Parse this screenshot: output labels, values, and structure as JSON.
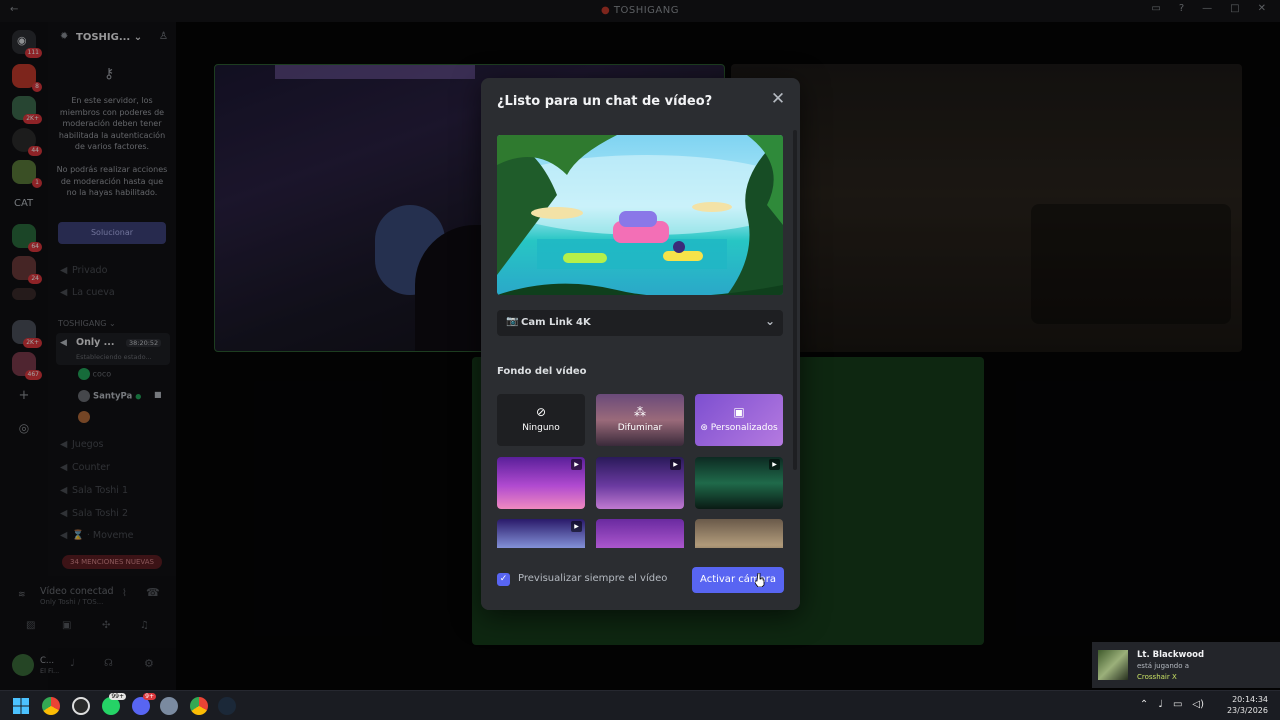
{
  "window": {
    "title": "TOSHIGANG"
  },
  "rail": {
    "category_label": "CAT",
    "servers": [
      {
        "badge": "111"
      },
      {
        "badge": "8"
      },
      {
        "badge": "2K+"
      },
      {
        "badge": "44"
      },
      {
        "badge": "1"
      },
      {
        "badge": "64"
      },
      {
        "badge": "24"
      },
      {
        "badge": ""
      },
      {
        "badge": "2K+"
      },
      {
        "badge": "467"
      }
    ]
  },
  "sidebar": {
    "guild_name": "TOSHIG...",
    "notice_1": "En este servidor, los miembros con poderes de moderación deben tener habilitada la autenticación de varios factores.",
    "notice_2": "No podrás realizar acciones de moderación hasta que no la hayas habilitado.",
    "fix_button": "Solucionar",
    "channels_top": [
      "Privado",
      "La cueva"
    ],
    "section": "TOSHIGANG",
    "active_voice": {
      "name": "Only ...",
      "time": "38:20:52",
      "status": "Estableciendo estado..."
    },
    "members": [
      "coco",
      "SantyPa",
      ""
    ],
    "channels_bottom": [
      "Juegos",
      "Counter",
      "Sala Toshi 1",
      "Sala Toshi 2",
      "⌛ · Moveme"
    ],
    "mentions_pill": "34 MENCIONES NUEVAS",
    "voice_connected": {
      "title": "Vídeo conectad",
      "subtitle": "Only Toshi / TOS..."
    },
    "user": {
      "name": "C...",
      "status": "El Fi..."
    }
  },
  "modal": {
    "title": "¿Listo para un chat de vídeo?",
    "camera_select": "Cam Link 4K",
    "background_label": "Fondo del vídeo",
    "options": [
      "Ninguno",
      "Difuminar",
      "Personalizados"
    ],
    "always_preview": "Previsualizar siempre el vídeo",
    "activate_button": "Activar cámara"
  },
  "toast": {
    "name": "Lt. Blackwood",
    "line": "está jugando a",
    "game": "Crosshair X"
  },
  "taskbar": {
    "badge_whatsapp": "99+",
    "badge_discord": "9+",
    "time": "20:14:34",
    "date": "23/3/2026"
  },
  "colors": {
    "accent": "#5865f2",
    "modal_bg": "#2b2d31",
    "input_bg": "#1e1f22",
    "danger": "#da373c",
    "green_tile": "#163d1b"
  }
}
